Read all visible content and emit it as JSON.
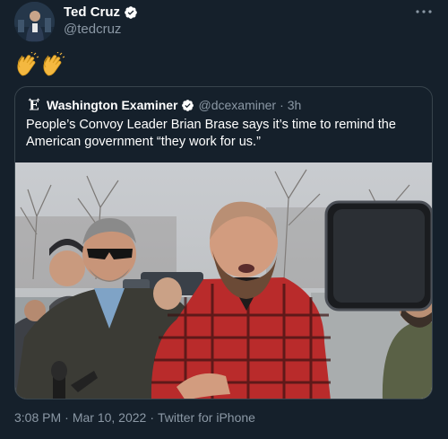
{
  "tweet": {
    "author": {
      "name": "Ted Cruz",
      "handle": "@tedcruz",
      "verified": true
    },
    "text_emoji": [
      "clapping-hands",
      "clapping-hands"
    ],
    "quoted": {
      "source_name": "Washington Examiner",
      "handle": "@dcexaminer",
      "separator": "·",
      "time": "3h",
      "verified": true,
      "text": "People’s Convoy Leader Brian Brase says it’s time to remind the American government “they work for us.”"
    },
    "footer": {
      "time": "3:08 PM",
      "date": "Mar 10, 2022",
      "separator": "·",
      "client": "Twitter for iPhone"
    }
  },
  "colors": {
    "background": "#15202b",
    "text_primary": "#ffffff",
    "text_secondary": "#8b98a5",
    "verified_badge": "#ffffff",
    "border": "#38444d"
  },
  "icons": {
    "verified": "verified-badge-icon",
    "more": "more-options-icon",
    "emoji": "clapping-hands-icon",
    "publisher_logo": "washington-examiner-logo-icon"
  }
}
